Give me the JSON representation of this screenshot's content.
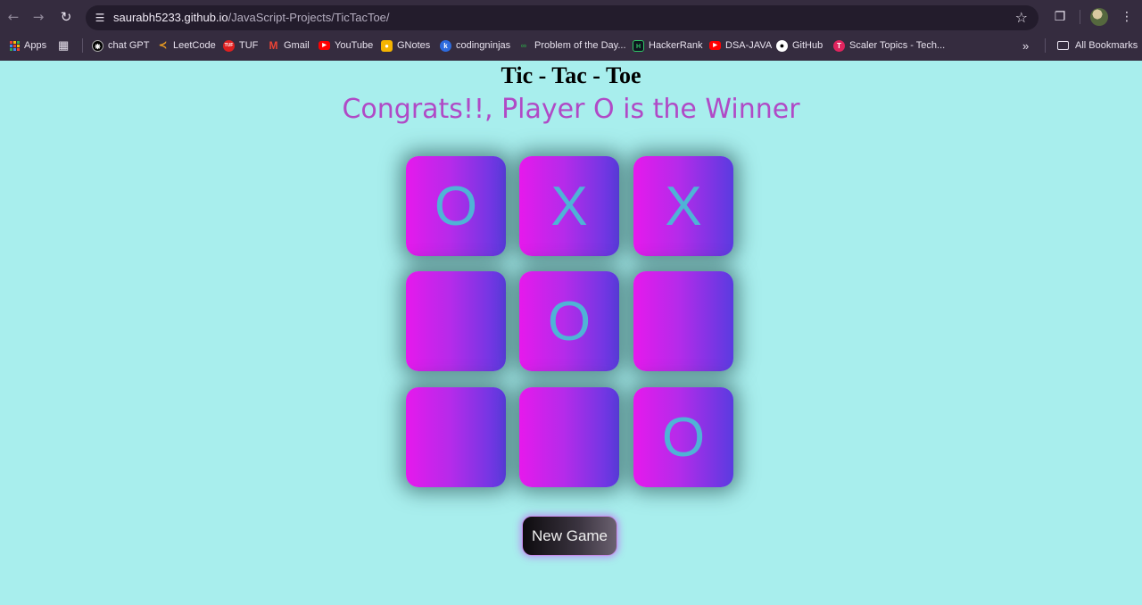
{
  "browser": {
    "url_host": "saurabh5233.github.io",
    "url_path": "/JavaScript-Projects/TicTacToe/",
    "icons": [
      "back-icon",
      "forward-icon",
      "reload-icon",
      "site-info-icon",
      "bookmark-star-icon",
      "extensions-icon",
      "profile-avatar",
      "menu-icon"
    ],
    "bookmarks": [
      {
        "label": "Apps",
        "icon": "apps-grid-icon"
      },
      {
        "label": "",
        "icon": "tab-groups-icon"
      },
      {
        "label": "chat GPT",
        "icon": "chatgpt-icon",
        "color": "#000000"
      },
      {
        "label": "LeetCode",
        "icon": "leetcode-icon",
        "color": "#f0a020"
      },
      {
        "label": "TUF",
        "icon": "tuf-icon",
        "color": "#e02020"
      },
      {
        "label": "Gmail",
        "icon": "gmail-icon",
        "color": "#ea4335"
      },
      {
        "label": "YouTube",
        "icon": "youtube-icon",
        "color": "#ff0000"
      },
      {
        "label": "GNotes",
        "icon": "gnotes-icon",
        "color": "#f5b400"
      },
      {
        "label": "codingninjas",
        "icon": "codingninjas-icon",
        "color": "#2d6bde"
      },
      {
        "label": "Problem of the Day...",
        "icon": "gfg-icon",
        "color": "#2f8d46"
      },
      {
        "label": "HackerRank",
        "icon": "hackerrank-icon",
        "color": "#0e141e"
      },
      {
        "label": "DSA-JAVA",
        "icon": "youtube-icon",
        "color": "#ff0000"
      },
      {
        "label": "GitHub",
        "icon": "github-icon",
        "color": "#ffffff"
      },
      {
        "label": "Scaler Topics - Tech...",
        "icon": "scaler-icon",
        "color": "#e0245e"
      }
    ],
    "all_bookmarks_label": "All Bookmarks"
  },
  "game": {
    "title": "Tic - Tac - Toe",
    "message": "Congrats!!, Player O is the Winner",
    "cells": [
      "O",
      "X",
      "X",
      "",
      "O",
      "",
      "",
      "",
      "O"
    ],
    "new_game_label": "New Game"
  }
}
